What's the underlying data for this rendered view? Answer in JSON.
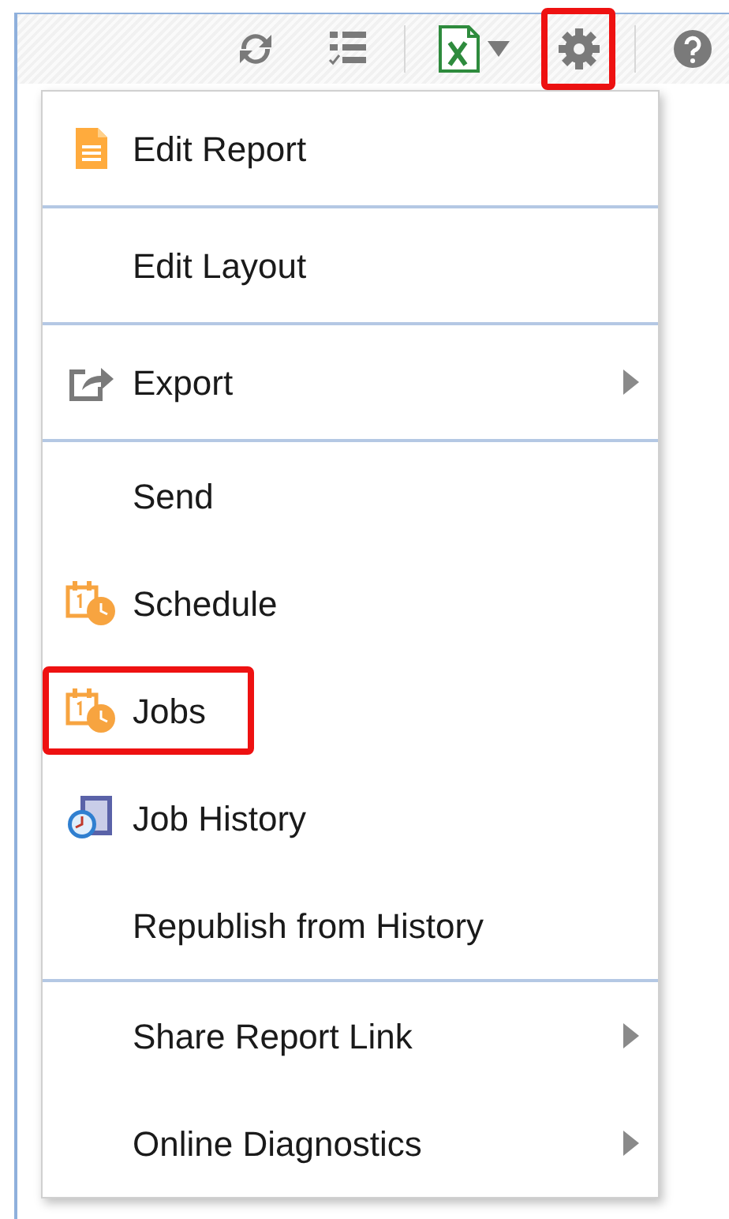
{
  "toolbar": {
    "items": [
      {
        "kind": "refresh",
        "highlighted": false
      },
      {
        "kind": "checklist",
        "highlighted": false
      },
      {
        "kind": "separator"
      },
      {
        "kind": "excel",
        "highlighted": false
      },
      {
        "kind": "settings",
        "highlighted": true
      },
      {
        "kind": "separator"
      },
      {
        "kind": "help",
        "highlighted": false
      }
    ]
  },
  "menu": {
    "sections": [
      [
        {
          "label": "Edit Report",
          "kind": "document",
          "submenu": false,
          "highlighted": false
        }
      ],
      [
        {
          "label": "Edit Layout",
          "kind": "plain",
          "submenu": false,
          "highlighted": false
        }
      ],
      [
        {
          "label": "Export",
          "kind": "export",
          "submenu": true,
          "highlighted": false
        }
      ],
      [
        {
          "label": "Send",
          "kind": "plain",
          "submenu": false,
          "highlighted": false
        },
        {
          "label": "Schedule",
          "kind": "schedule",
          "submenu": false,
          "highlighted": false
        },
        {
          "label": "Jobs",
          "kind": "schedule",
          "submenu": false,
          "highlighted": true
        },
        {
          "label": "Job History",
          "kind": "history",
          "submenu": false,
          "highlighted": false
        },
        {
          "label": "Republish from History",
          "kind": "plain",
          "submenu": false,
          "highlighted": false
        }
      ],
      [
        {
          "label": "Share Report Link",
          "kind": "plain",
          "submenu": true,
          "highlighted": false
        },
        {
          "label": "Online Diagnostics",
          "kind": "plain",
          "submenu": true,
          "highlighted": false
        }
      ]
    ]
  }
}
